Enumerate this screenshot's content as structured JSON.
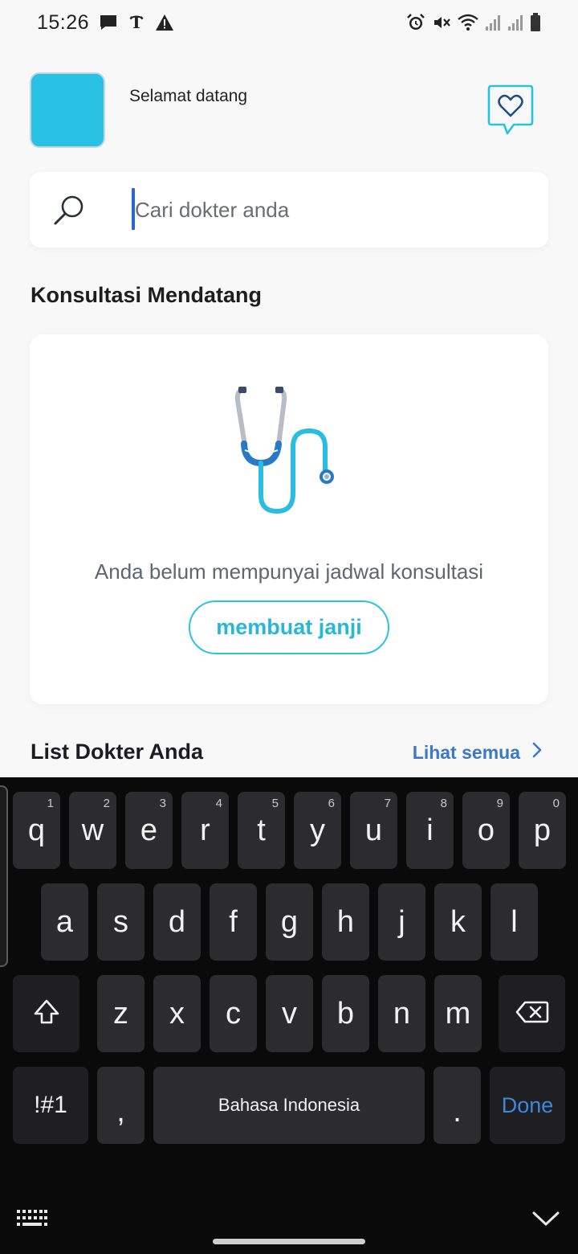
{
  "status_bar": {
    "time": "15:26",
    "left_icons": [
      "message-icon",
      "nyt-icon",
      "warning-icon"
    ],
    "right_icons": [
      "alarm-icon",
      "mute-icon",
      "wifi-icon",
      "signal-icon",
      "signal-icon",
      "battery-icon"
    ]
  },
  "header": {
    "welcome": "Selamat datang",
    "avatar_color": "#29c2e4",
    "accent_color": "#29c2e4"
  },
  "search": {
    "placeholder": "Cari dokter anda",
    "value": ""
  },
  "upcoming": {
    "title": "Konsultasi Mendatang",
    "empty_text": "Anda belum mempunyai jadwal konsultasi",
    "button_label": "membuat janji"
  },
  "doctors": {
    "title": "List Dokter Anda",
    "see_all": "Lihat semua"
  },
  "keyboard": {
    "row1": [
      {
        "key": "q",
        "hint": "1"
      },
      {
        "key": "w",
        "hint": "2"
      },
      {
        "key": "e",
        "hint": "3"
      },
      {
        "key": "r",
        "hint": "4"
      },
      {
        "key": "t",
        "hint": "5"
      },
      {
        "key": "y",
        "hint": "6"
      },
      {
        "key": "u",
        "hint": "7"
      },
      {
        "key": "i",
        "hint": "8"
      },
      {
        "key": "o",
        "hint": "9"
      },
      {
        "key": "p",
        "hint": "0"
      }
    ],
    "row2": [
      "a",
      "s",
      "d",
      "f",
      "g",
      "h",
      "j",
      "k",
      "l"
    ],
    "row3": [
      "z",
      "x",
      "c",
      "v",
      "b",
      "n",
      "m"
    ],
    "symbols": "!#1",
    "comma": ",",
    "space": "Bahasa Indonesia",
    "period": ".",
    "done": "Done"
  }
}
